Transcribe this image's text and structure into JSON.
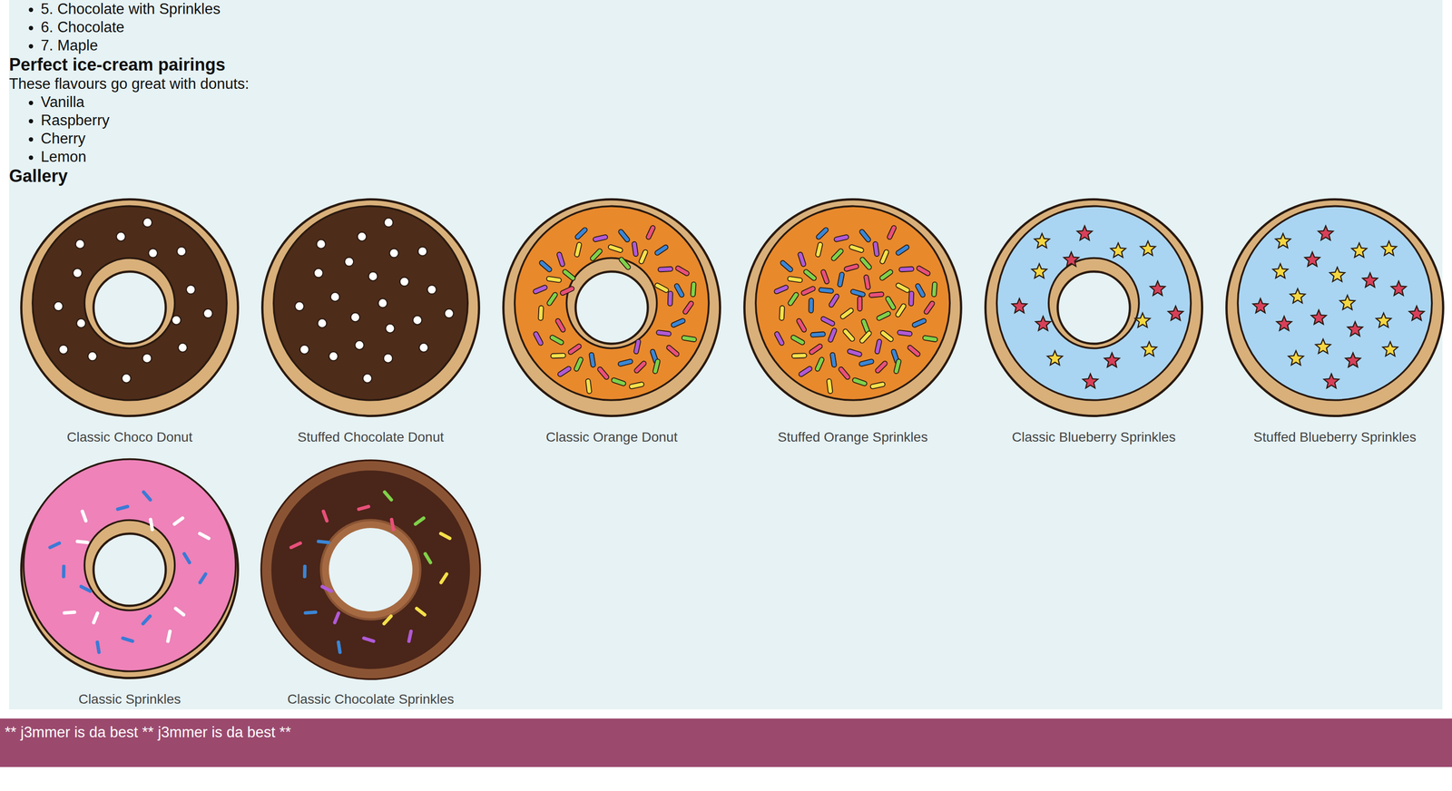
{
  "flavours": [
    "5. Chocolate with Sprinkles",
    "6. Chocolate",
    "7. Maple"
  ],
  "pairings": {
    "title": "Perfect ice-cream pairings",
    "intro": "These flavours go great with donuts:",
    "items": [
      "Vanilla",
      "Raspberry",
      "Cherry",
      "Lemon"
    ]
  },
  "gallery": {
    "title": "Gallery",
    "items": [
      {
        "caption": "Classic Choco Donut",
        "kind": "ring-dots",
        "color": "#4e2c1a"
      },
      {
        "caption": "Stuffed Chocolate Donut",
        "kind": "filled-dots",
        "color": "#4e2c1a"
      },
      {
        "caption": "Classic Orange Donut",
        "kind": "ring-sprinkles",
        "color": "#e8892c"
      },
      {
        "caption": "Stuffed Orange Sprinkles",
        "kind": "filled-sprinkles",
        "color": "#e8892c"
      },
      {
        "caption": "Classic Blueberry Sprinkles",
        "kind": "ring-stars",
        "color": "#a9d5f2"
      },
      {
        "caption": "Stuffed Blueberry Sprinkles",
        "kind": "filled-stars",
        "color": "#a9d5f2"
      },
      {
        "caption": "Classic Sprinkles",
        "kind": "ring-lines",
        "color": "#ee82b9"
      },
      {
        "caption": "Classic Chocolate Sprinkles",
        "kind": "ring-lines",
        "color": "#4a2519"
      }
    ]
  },
  "footer": {
    "text": "** j3mmer is da best ** j3mmer is da best **"
  }
}
